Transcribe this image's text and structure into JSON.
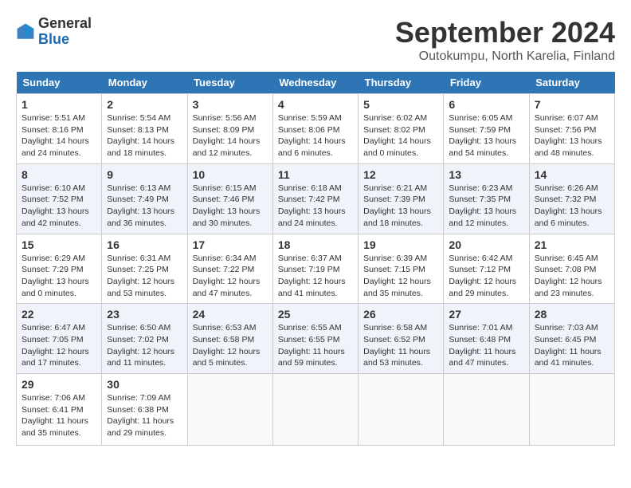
{
  "header": {
    "logo": {
      "general": "General",
      "blue": "Blue"
    },
    "title": "September 2024",
    "subtitle": "Outokumpu, North Karelia, Finland"
  },
  "calendar": {
    "days_of_week": [
      "Sunday",
      "Monday",
      "Tuesday",
      "Wednesday",
      "Thursday",
      "Friday",
      "Saturday"
    ],
    "weeks": [
      [
        {
          "day": "1",
          "info": "Sunrise: 5:51 AM\nSunset: 8:16 PM\nDaylight: 14 hours\nand 24 minutes."
        },
        {
          "day": "2",
          "info": "Sunrise: 5:54 AM\nSunset: 8:13 PM\nDaylight: 14 hours\nand 18 minutes."
        },
        {
          "day": "3",
          "info": "Sunrise: 5:56 AM\nSunset: 8:09 PM\nDaylight: 14 hours\nand 12 minutes."
        },
        {
          "day": "4",
          "info": "Sunrise: 5:59 AM\nSunset: 8:06 PM\nDaylight: 14 hours\nand 6 minutes."
        },
        {
          "day": "5",
          "info": "Sunrise: 6:02 AM\nSunset: 8:02 PM\nDaylight: 14 hours\nand 0 minutes."
        },
        {
          "day": "6",
          "info": "Sunrise: 6:05 AM\nSunset: 7:59 PM\nDaylight: 13 hours\nand 54 minutes."
        },
        {
          "day": "7",
          "info": "Sunrise: 6:07 AM\nSunset: 7:56 PM\nDaylight: 13 hours\nand 48 minutes."
        }
      ],
      [
        {
          "day": "8",
          "info": "Sunrise: 6:10 AM\nSunset: 7:52 PM\nDaylight: 13 hours\nand 42 minutes."
        },
        {
          "day": "9",
          "info": "Sunrise: 6:13 AM\nSunset: 7:49 PM\nDaylight: 13 hours\nand 36 minutes."
        },
        {
          "day": "10",
          "info": "Sunrise: 6:15 AM\nSunset: 7:46 PM\nDaylight: 13 hours\nand 30 minutes."
        },
        {
          "day": "11",
          "info": "Sunrise: 6:18 AM\nSunset: 7:42 PM\nDaylight: 13 hours\nand 24 minutes."
        },
        {
          "day": "12",
          "info": "Sunrise: 6:21 AM\nSunset: 7:39 PM\nDaylight: 13 hours\nand 18 minutes."
        },
        {
          "day": "13",
          "info": "Sunrise: 6:23 AM\nSunset: 7:35 PM\nDaylight: 13 hours\nand 12 minutes."
        },
        {
          "day": "14",
          "info": "Sunrise: 6:26 AM\nSunset: 7:32 PM\nDaylight: 13 hours\nand 6 minutes."
        }
      ],
      [
        {
          "day": "15",
          "info": "Sunrise: 6:29 AM\nSunset: 7:29 PM\nDaylight: 13 hours\nand 0 minutes."
        },
        {
          "day": "16",
          "info": "Sunrise: 6:31 AM\nSunset: 7:25 PM\nDaylight: 12 hours\nand 53 minutes."
        },
        {
          "day": "17",
          "info": "Sunrise: 6:34 AM\nSunset: 7:22 PM\nDaylight: 12 hours\nand 47 minutes."
        },
        {
          "day": "18",
          "info": "Sunrise: 6:37 AM\nSunset: 7:19 PM\nDaylight: 12 hours\nand 41 minutes."
        },
        {
          "day": "19",
          "info": "Sunrise: 6:39 AM\nSunset: 7:15 PM\nDaylight: 12 hours\nand 35 minutes."
        },
        {
          "day": "20",
          "info": "Sunrise: 6:42 AM\nSunset: 7:12 PM\nDaylight: 12 hours\nand 29 minutes."
        },
        {
          "day": "21",
          "info": "Sunrise: 6:45 AM\nSunset: 7:08 PM\nDaylight: 12 hours\nand 23 minutes."
        }
      ],
      [
        {
          "day": "22",
          "info": "Sunrise: 6:47 AM\nSunset: 7:05 PM\nDaylight: 12 hours\nand 17 minutes."
        },
        {
          "day": "23",
          "info": "Sunrise: 6:50 AM\nSunset: 7:02 PM\nDaylight: 12 hours\nand 11 minutes."
        },
        {
          "day": "24",
          "info": "Sunrise: 6:53 AM\nSunset: 6:58 PM\nDaylight: 12 hours\nand 5 minutes."
        },
        {
          "day": "25",
          "info": "Sunrise: 6:55 AM\nSunset: 6:55 PM\nDaylight: 11 hours\nand 59 minutes."
        },
        {
          "day": "26",
          "info": "Sunrise: 6:58 AM\nSunset: 6:52 PM\nDaylight: 11 hours\nand 53 minutes."
        },
        {
          "day": "27",
          "info": "Sunrise: 7:01 AM\nSunset: 6:48 PM\nDaylight: 11 hours\nand 47 minutes."
        },
        {
          "day": "28",
          "info": "Sunrise: 7:03 AM\nSunset: 6:45 PM\nDaylight: 11 hours\nand 41 minutes."
        }
      ],
      [
        {
          "day": "29",
          "info": "Sunrise: 7:06 AM\nSunset: 6:41 PM\nDaylight: 11 hours\nand 35 minutes."
        },
        {
          "day": "30",
          "info": "Sunrise: 7:09 AM\nSunset: 6:38 PM\nDaylight: 11 hours\nand 29 minutes."
        },
        {
          "day": "",
          "info": ""
        },
        {
          "day": "",
          "info": ""
        },
        {
          "day": "",
          "info": ""
        },
        {
          "day": "",
          "info": ""
        },
        {
          "day": "",
          "info": ""
        }
      ]
    ]
  }
}
